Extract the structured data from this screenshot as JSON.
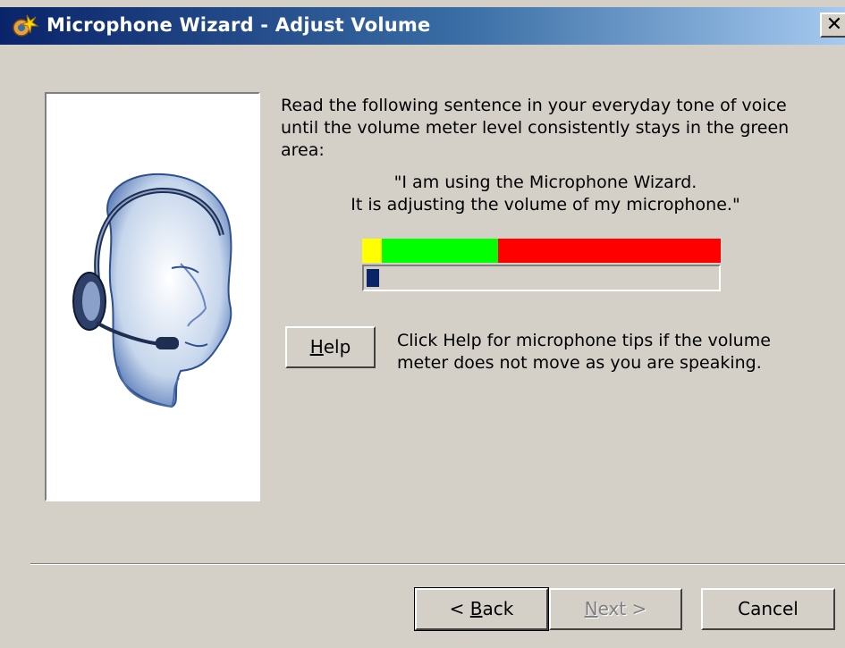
{
  "window": {
    "title": "Microphone Wizard - Adjust Volume",
    "close_label": "✕",
    "title_icon": "microphone-wizard-icon"
  },
  "illustration": {
    "icon": "headset-person-icon"
  },
  "instructions": {
    "text": "Read the following sentence in your everyday tone of voice until the volume meter level consistently stays in the green area:",
    "quote_line1": "\"I am using the Microphone Wizard.",
    "quote_line2": "It is adjusting the volume of my microphone.\""
  },
  "volume_meter": {
    "scale_colors": {
      "low": "#ffff00",
      "ok": "#00ff00",
      "high": "#ff0000"
    },
    "scale_fractions": {
      "low": 0.055,
      "ok": 0.325,
      "high": 0.62
    },
    "level_fraction": 0.035,
    "level_color": "#0a246a"
  },
  "help": {
    "button_label_accel": "H",
    "button_label_rest": "elp",
    "text": "Click Help for microphone tips if the volume meter does not move as you are speaking."
  },
  "footer": {
    "back_prefix": "< ",
    "back_accel": "B",
    "back_rest": "ack",
    "next_accel": "N",
    "next_rest": "ext",
    "next_suffix": " >",
    "cancel_label": "Cancel"
  }
}
